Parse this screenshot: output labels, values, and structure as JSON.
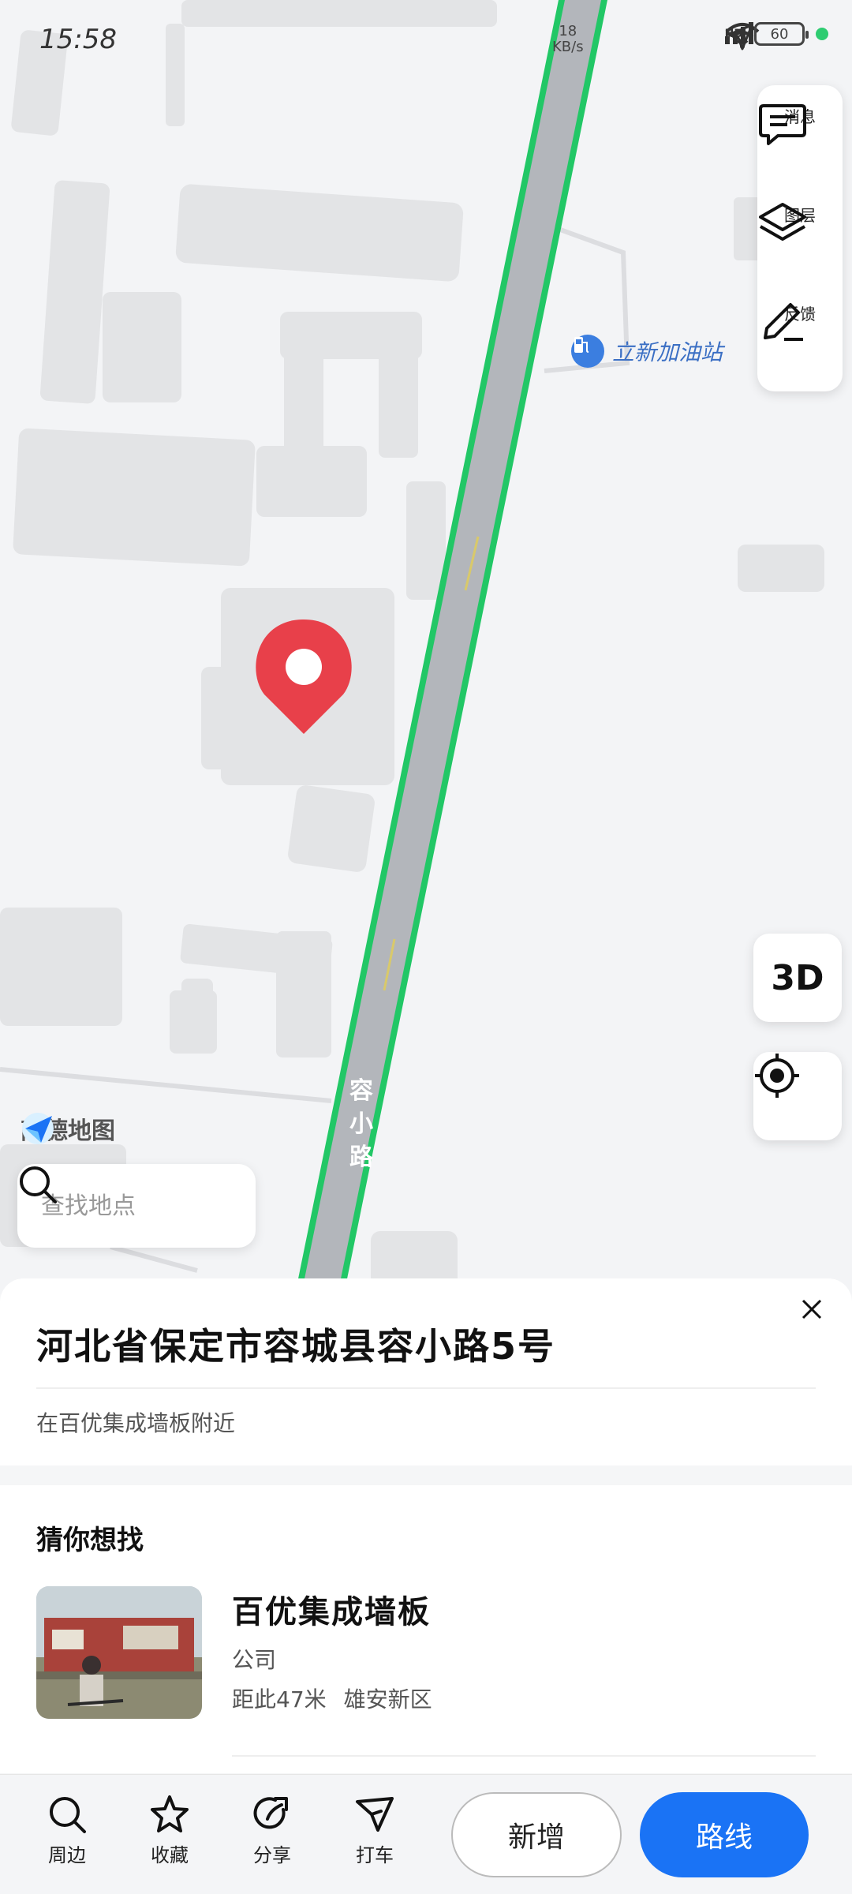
{
  "status_bar": {
    "time": "15:58",
    "net_speed_value": "18",
    "net_speed_unit": "KB/s",
    "hd_label": "HD",
    "battery": "60"
  },
  "map": {
    "tools": {
      "message_label": "消息",
      "layers_label": "图层",
      "feedback_label": "反馈"
    },
    "btn_3d": "3D",
    "poi_gas_station": "立新加油站",
    "road_name": [
      "容",
      "小",
      "路"
    ],
    "logo_text": "高德地图",
    "search_placeholder": "查找地点"
  },
  "sheet": {
    "address": "河北省保定市容城县容小路5号",
    "nearby": "在百优集成墙板附近",
    "guess_title": "猜你想找",
    "place": {
      "name": "百优集成墙板",
      "category": "公司",
      "distance": "距此47米",
      "area": "雄安新区"
    }
  },
  "bottom_nav": {
    "items": [
      {
        "label": "周边",
        "icon": "search-icon"
      },
      {
        "label": "收藏",
        "icon": "star-icon"
      },
      {
        "label": "分享",
        "icon": "share-icon"
      },
      {
        "label": "打车",
        "icon": "taxi-icon"
      }
    ],
    "add_label": "新增",
    "route_label": "路线",
    "route_color": "#1a73f5"
  }
}
